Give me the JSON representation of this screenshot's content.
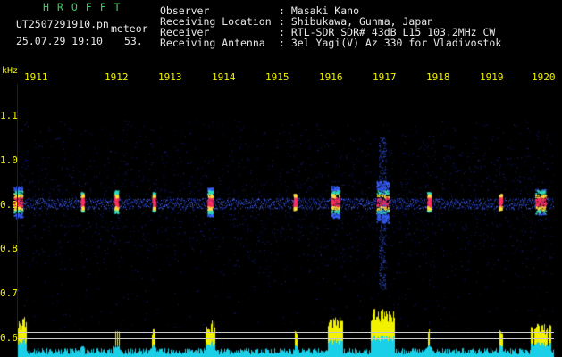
{
  "header": {
    "title": "HROFFT",
    "filename": "UT2507291910.pn",
    "tag": "meteor",
    "datetime": "25.07.29 19:10",
    "count": "53."
  },
  "info": [
    {
      "label": "Observer",
      "value": ": Masaki Kano"
    },
    {
      "label": "Receiving Location",
      "value": ": Shibukawa, Gunma, Japan"
    },
    {
      "label": "Receiver",
      "value": ": RTL-SDR SDR# 43dB L15 103.2MHz CW"
    },
    {
      "label": "Receiving Antenna",
      "value": ": 3el Yagi(V) Az 330 for Vladivostok"
    }
  ],
  "axis": {
    "y_unit": "kHz",
    "y_ticks": [
      "1.1",
      "1.0",
      "0.9",
      "0.8",
      "0.7",
      "0.6"
    ],
    "x_ticks": [
      "1911",
      "1912",
      "1913",
      "1914",
      "1915",
      "1916",
      "1917",
      "1918",
      "1919",
      "1920"
    ]
  },
  "colors": {
    "background": "#000000",
    "text_green": "#3bd05a",
    "text_white": "#e8e8e8",
    "text_yellow": "#f2f200",
    "noise": "#1a2a9a",
    "meteor_hot": "#ff3060"
  }
}
